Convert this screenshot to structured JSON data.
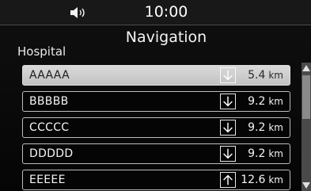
{
  "status_bar": {
    "speaker_icon": "speaker-volume-icon",
    "time": "10:00"
  },
  "header": {
    "title": "Navigation",
    "section_label": "Hospital"
  },
  "list": {
    "items": [
      {
        "name": "AAAAA",
        "direction_icon": "arrow-down-icon",
        "distance": "5.4",
        "unit": "km",
        "selected": true
      },
      {
        "name": "BBBBB",
        "direction_icon": "arrow-down-icon",
        "distance": "9.2",
        "unit": "km",
        "selected": false
      },
      {
        "name": "CCCCC",
        "direction_icon": "arrow-down-icon",
        "distance": "9.2",
        "unit": "km",
        "selected": false
      },
      {
        "name": "DDDDD",
        "direction_icon": "arrow-down-icon",
        "distance": "9.2",
        "unit": "km",
        "selected": false
      },
      {
        "name": "EEEEE",
        "direction_icon": "arrow-up-icon",
        "distance": "12.6",
        "unit": "km",
        "selected": false
      }
    ]
  },
  "scrollbar": {
    "up_icon": "scroll-up-triangle-icon",
    "down_icon": "scroll-down-triangle-icon"
  },
  "colors": {
    "background": "#0a0a0a",
    "selected_row": "#cfcfcf",
    "row_border": "#bdbdbd",
    "text": "#f5f5f5"
  }
}
